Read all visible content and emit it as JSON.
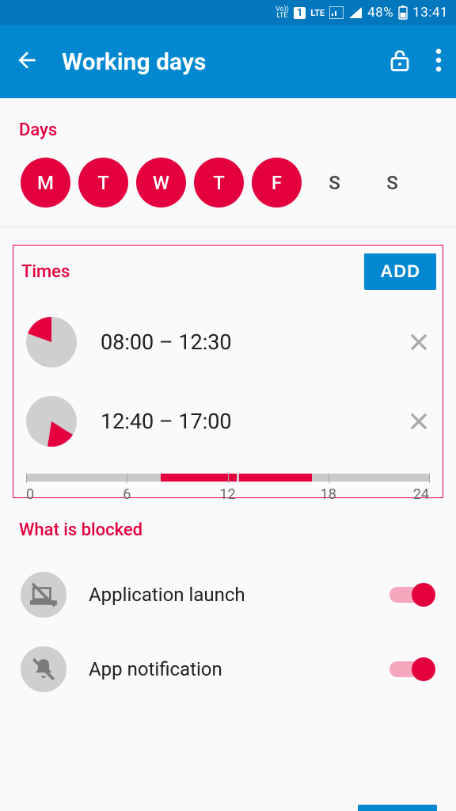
{
  "status": {
    "vo_lte": "Vo))\nLTE",
    "sim": "1",
    "lte": "LTE",
    "battery_pct": "48%",
    "clock": "13:41"
  },
  "header": {
    "title": "Working days"
  },
  "days": {
    "section_title": "Days",
    "items": [
      {
        "label": "M",
        "selected": true
      },
      {
        "label": "T",
        "selected": true
      },
      {
        "label": "W",
        "selected": true
      },
      {
        "label": "T",
        "selected": true
      },
      {
        "label": "F",
        "selected": true
      },
      {
        "label": "S",
        "selected": false
      },
      {
        "label": "S",
        "selected": false
      }
    ]
  },
  "times": {
    "section_title": "Times",
    "add_label": "ADD",
    "items": [
      {
        "label": "08:00 – 12:30",
        "start_angle": -90,
        "sweep_angle": 67,
        "start_pct": 33.3,
        "end_pct": 52.1
      },
      {
        "label": "12:40 – 17:00",
        "start_angle": 100,
        "sweep_angle": 65,
        "start_pct": 52.8,
        "end_pct": 70.8
      }
    ],
    "timeline_labels": [
      "0",
      "6",
      "12",
      "18",
      "24"
    ]
  },
  "blocked": {
    "section_title": "What is blocked",
    "items": [
      {
        "label": "Application launch",
        "icon": "laptop-off-icon",
        "enabled": true
      },
      {
        "label": "App notification",
        "icon": "bell-off-icon",
        "enabled": true
      }
    ]
  },
  "colors": {
    "primary": "#0288d1",
    "accent": "#e4003e"
  }
}
